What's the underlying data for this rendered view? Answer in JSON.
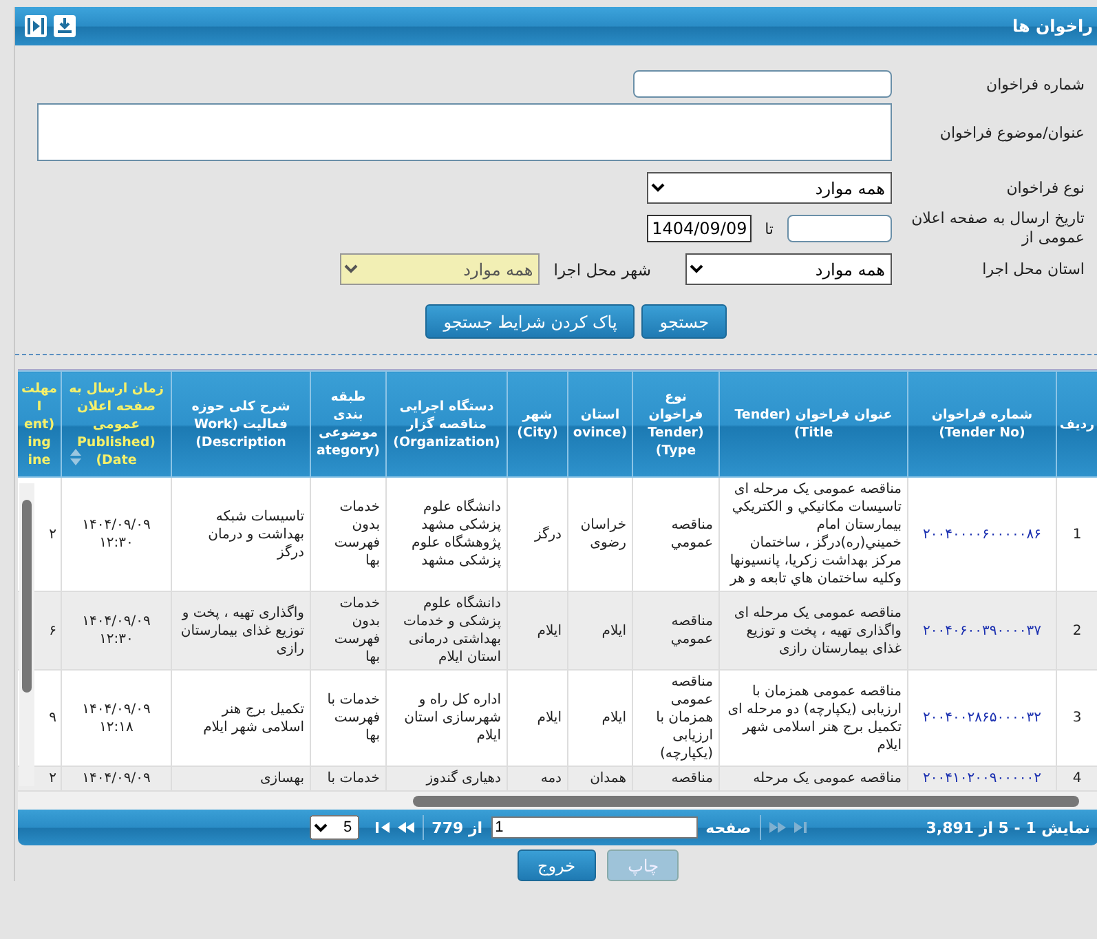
{
  "window": {
    "title": "راخوان ها"
  },
  "form": {
    "tender_no": {
      "label": "شماره فراخوان"
    },
    "subject": {
      "label": "عنوان/موضوع فراخوان"
    },
    "type": {
      "label": "نوع فراخوان",
      "value": "همه موارد"
    },
    "date": {
      "label": "تاریخ ارسال به صفحه اعلان عمومی از",
      "to_label": "تا",
      "to": "1404/09/09"
    },
    "province": {
      "label": "استان محل اجرا",
      "value": "همه موارد"
    },
    "city": {
      "label": "شهر محل اجرا",
      "value": "همه موارد",
      "disabled": true
    }
  },
  "buttons": [
    {
      "label": "جستجو",
      "kind": "primary"
    },
    {
      "label": "پاک کردن شرایط جستجو",
      "kind": "primary"
    }
  ],
  "table": {
    "columns": [
      {
        "lines": [
          "ردیف"
        ],
        "kind": "index"
      },
      {
        "lines": [
          "شماره فراخوان",
          "(Tender No)"
        ],
        "kind": "link"
      },
      {
        "lines": [
          "عنوان فراخوان (Tender",
          "(Title"
        ],
        "kind": "text"
      },
      {
        "lines": [
          "نوع",
          "فراخوان",
          "Tender)",
          "(Type"
        ],
        "kind": "text"
      },
      {
        "lines": [
          "استان",
          "ovince)"
        ],
        "kind": "text"
      },
      {
        "lines": [
          "شهر",
          "(City)"
        ],
        "kind": "text"
      },
      {
        "lines": [
          "دستگاه اجرایی",
          "مناقصه گزار",
          "(Organization)"
        ],
        "kind": "text"
      },
      {
        "lines": [
          "طبقه",
          "بندی",
          "موضوعی",
          "ategory)"
        ],
        "kind": "text"
      },
      {
        "lines": [
          "شرح کلی حوزه",
          "فعالیت (Work",
          "(Description"
        ],
        "kind": "text"
      },
      {
        "lines": [
          "زمان ارسال به",
          "صفحه اعلان",
          "عمومی",
          "Published)",
          "(Date"
        ],
        "kind": "date"
      },
      {
        "lines": [
          "مهلت",
          "I",
          "ent)",
          "ing",
          "ine"
        ],
        "kind": "deadline"
      }
    ],
    "rows": [
      {
        "cells": [
          "1",
          "۲۰۰۴۰۰۰۰۶۰۰۰۰۰۸۶",
          "مناقصه عمومی یک مرحله ای تاسیسات مکانیکي و الکتریکي بیمارستان امام خمیني(ره)درگز ، ساختمان مرکز بهداشت زکریا، پانسیونها وکلیه ساختمان هاي تابعه و هر",
          "مناقصه عمومي",
          "خراسان رضوی",
          "درگز",
          "دانشگاه علوم پزشکی مشهد پژوهشگاه علوم پزشکی مشهد",
          "خدمات بدون فهرست بها",
          "تاسیسات شبکه بهداشت و درمان درگز",
          "۱۴۰۴/۰۹/۰۹ ۱۲:۳۰",
          "۲"
        ]
      },
      {
        "cells": [
          "2",
          "۲۰۰۴۰۶۰۰۳۹۰۰۰۰۳۷",
          "مناقصه عمومی یک مرحله ای واگذاری تهیه ، پخت و توزیع غذای بیمارستان رازی",
          "مناقصه عمومي",
          "ایلام",
          "ایلام",
          "دانشگاه علوم پزشکی و خدمات بهداشتی درمانی استان ایلام",
          "خدمات بدون فهرست بها",
          "واگذاری تهیه ، پخت و توزیع غذای بیمارستان رازی",
          "۱۴۰۴/۰۹/۰۹ ۱۲:۳۰",
          "۶"
        ]
      },
      {
        "cells": [
          "3",
          "۲۰۰۴۰۰۲۸۶۵۰۰۰۰۳۲",
          "مناقصه عمومی همزمان با ارزیابی (یکپارچه) دو مرحله ای تکمیل برج هنر اسلامی شهر ایلام",
          "مناقصه عمومی همزمان با ارزیابی (یکپارچه)",
          "ایلام",
          "ایلام",
          "اداره کل راه و شهرسازی استان ایلام",
          "خدمات با فهرست بها",
          "تکمیل برج هنر اسلامی شهر ایلام",
          "۱۴۰۴/۰۹/۰۹ ۱۲:۱۸",
          "۹"
        ]
      },
      {
        "cells": [
          "4",
          "۲۰۰۴۱۰۲۰۰۹۰۰۰۰۰۲",
          "مناقصه عمومی یک مرحله",
          "مناقصه",
          "همدان",
          "دمه",
          "دهیاری گندوز",
          "خدمات با",
          "بهسازی",
          "۱۴۰۴/۰۹/۰۹",
          "۲"
        ]
      }
    ]
  },
  "pager": {
    "summary": "نمایش 1 - 5 از 3,891",
    "page_label": "صفحه",
    "page": "1",
    "of": "از 779",
    "page_size": "5"
  },
  "footer_buttons": [
    {
      "label": "چاپ",
      "disabled": true
    },
    {
      "label": "خروج",
      "disabled": false
    }
  ]
}
